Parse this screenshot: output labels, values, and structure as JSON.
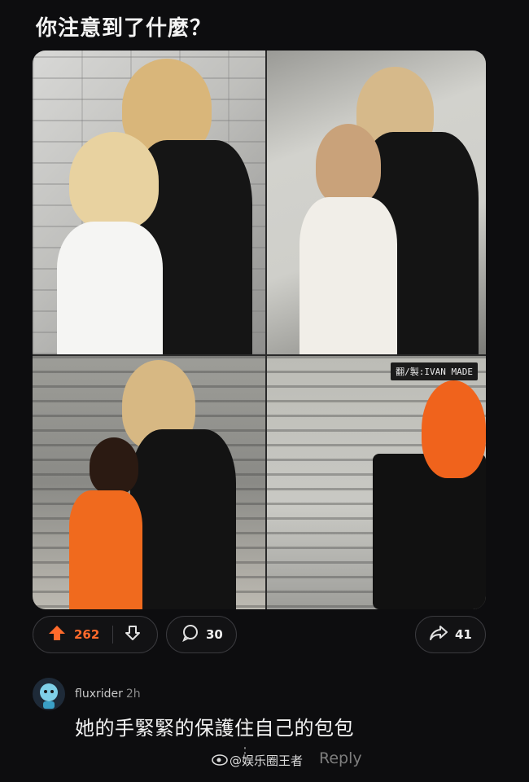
{
  "post": {
    "title": "你注意到了什麼？",
    "image_credit": "翻/製:IVAN MADE"
  },
  "actions": {
    "upvotes": "262",
    "comments": "30",
    "shares": "41"
  },
  "comment": {
    "username": "fluxrider",
    "time": "2h",
    "text": "她的手緊緊的保護住自己的包包"
  },
  "footer": {
    "reply_label": "Reply",
    "watermark": "@娱乐圈王者"
  },
  "colors": {
    "upvote": "#ff6a2b",
    "background": "#0d0d0f"
  }
}
